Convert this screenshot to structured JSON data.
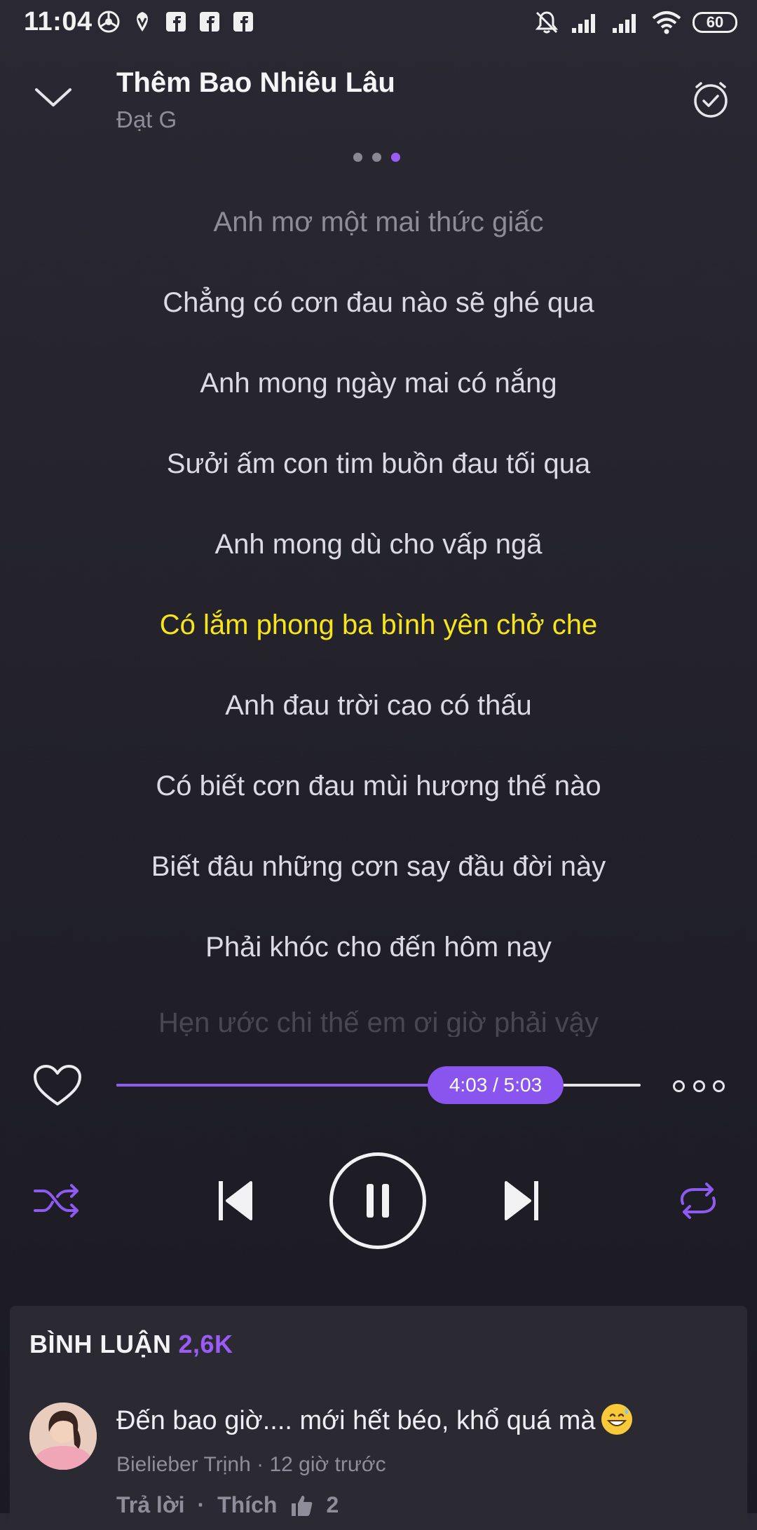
{
  "status_bar": {
    "time": "11:04",
    "battery": "60",
    "icons": [
      "chrome-icon",
      "vpn-icon",
      "facebook-icon",
      "facebook-icon",
      "facebook-icon",
      "mute-icon",
      "signal-icon",
      "signal-icon",
      "wifi-icon"
    ]
  },
  "header": {
    "title": "Thêm Bao Nhiêu Lâu",
    "artist": "Đạt G"
  },
  "pager": {
    "count": 3,
    "active_index": 2
  },
  "lyrics": {
    "lines": [
      "Anh mơ một mai thức giấc",
      "Chẳng có cơn đau nào sẽ ghé qua",
      "Anh mong ngày mai có nắng",
      "Sưởi ấm con tim buồn đau tối qua",
      "Anh mong dù cho vấp ngã",
      "Có lắm phong ba bình yên chở che",
      "Anh đau trời cao có thấu",
      "Có biết cơn đau mùi hương thế nào",
      "Biết đâu những cơn say đầu đời này",
      "Phải khóc cho đến hôm nay",
      "Hẹn ước chi thế em ơi giờ phải vậy"
    ],
    "current_index": 5
  },
  "player": {
    "time_label": "4:03 / 5:03",
    "progress_fraction": 0.8
  },
  "comments": {
    "heading": "BÌNH LUẬN",
    "count": "2,6K",
    "items": [
      {
        "text": "Đến bao giờ.... mới hết béo, khổ quá mà",
        "author": "Bielieber Trịnh",
        "time": "12 giờ trước",
        "reply_label": "Trả lời",
        "like_label": "Thích",
        "like_count": "2"
      }
    ]
  },
  "colors": {
    "accent": "#9b5cf6",
    "current_lyric": "#f6e51c",
    "background": "#24232b"
  }
}
